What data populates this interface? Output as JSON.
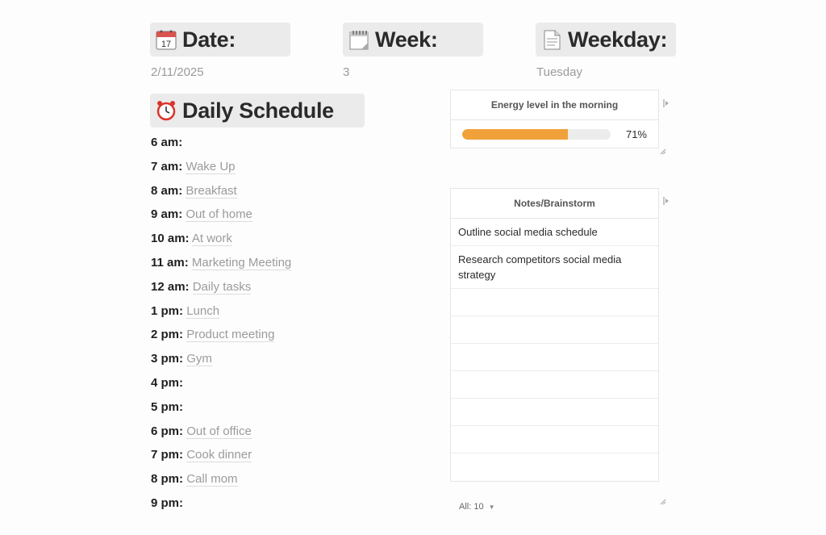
{
  "header": {
    "date": {
      "title": "Date:",
      "value": "2/11/2025",
      "icon": "calendar-icon"
    },
    "week": {
      "title": "Week:",
      "value": "3",
      "icon": "spiral-calendar-icon"
    },
    "weekday": {
      "title": "Weekday:",
      "value": "Tuesday",
      "icon": "page-icon"
    }
  },
  "schedule": {
    "title": "Daily Schedule",
    "icon": "alarm-clock-icon",
    "rows": [
      {
        "time": "6 am:",
        "activity": ""
      },
      {
        "time": "7 am:",
        "activity": "Wake Up"
      },
      {
        "time": "8 am:",
        "activity": "Breakfast"
      },
      {
        "time": "9 am:",
        "activity": "Out of home"
      },
      {
        "time": "10 am:",
        "activity": "At work"
      },
      {
        "time": "11 am:",
        "activity": "Marketing Meeting"
      },
      {
        "time": "12 am:",
        "activity": "Daily tasks"
      },
      {
        "time": "1 pm:",
        "activity": "Lunch"
      },
      {
        "time": "2 pm:",
        "activity": "Product meeting"
      },
      {
        "time": "3 pm:",
        "activity": "Gym"
      },
      {
        "time": "4 pm:",
        "activity": ""
      },
      {
        "time": "5 pm:",
        "activity": ""
      },
      {
        "time": "6 pm:",
        "activity": "Out of office"
      },
      {
        "time": "7 pm:",
        "activity": "Cook dinner"
      },
      {
        "time": "8 pm:",
        "activity": "Call mom"
      },
      {
        "time": "9 pm:",
        "activity": ""
      }
    ]
  },
  "energy": {
    "header": "Energy level in the morning",
    "value": 0.71,
    "label": "71%",
    "color": "#f0a13a"
  },
  "notes": {
    "header": "Notes/Brainstorm",
    "rows": [
      "Outline social media schedule",
      "Research competitors social media strategy",
      "",
      "",
      "",
      "",
      "",
      "",
      "",
      ""
    ],
    "count_label": "All: 10"
  }
}
